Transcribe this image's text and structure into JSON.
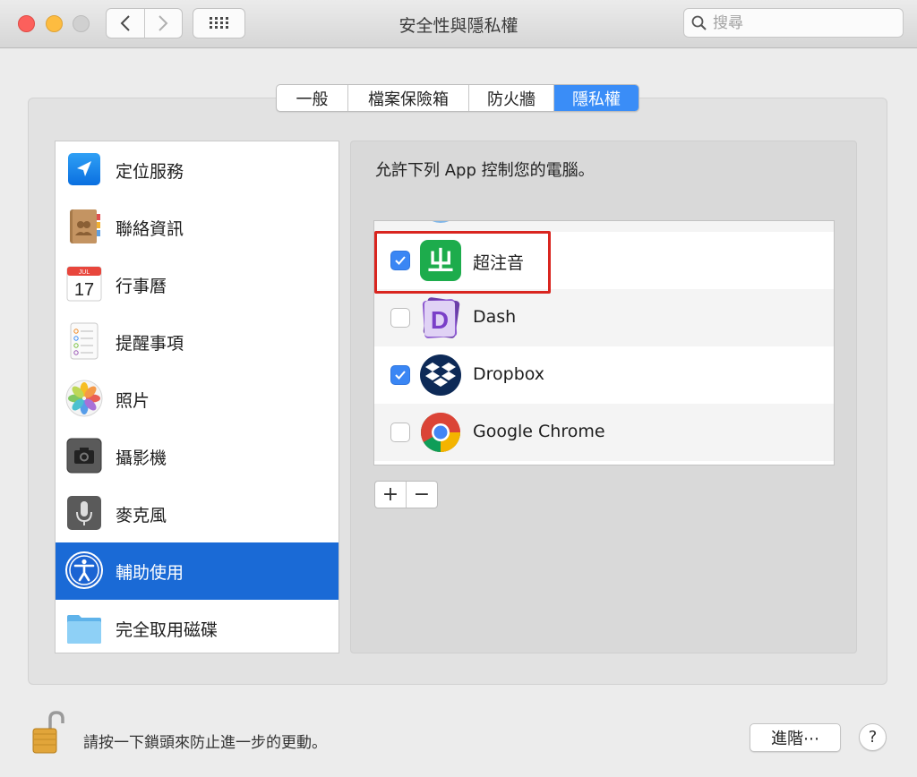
{
  "window": {
    "title": "安全性與隱私權"
  },
  "search": {
    "placeholder": "搜尋"
  },
  "tabs": [
    {
      "label": "一般",
      "active": false
    },
    {
      "label": "檔案保險箱",
      "active": false
    },
    {
      "label": "防火牆",
      "active": false
    },
    {
      "label": "隱私權",
      "active": true
    }
  ],
  "sidebar": {
    "items": [
      {
        "label": "定位服務",
        "icon": "location-arrow-icon"
      },
      {
        "label": "聯絡資訊",
        "icon": "contacts-book-icon"
      },
      {
        "label": "行事曆",
        "icon": "calendar-icon",
        "cal_month": "JUL",
        "cal_day": "17"
      },
      {
        "label": "提醒事項",
        "icon": "reminders-list-icon"
      },
      {
        "label": "照片",
        "icon": "photos-flower-icon"
      },
      {
        "label": "攝影機",
        "icon": "camera-icon"
      },
      {
        "label": "麥克風",
        "icon": "microphone-icon"
      },
      {
        "label": "輔助使用",
        "icon": "accessibility-icon",
        "selected": true
      },
      {
        "label": "完全取用磁碟",
        "icon": "folder-icon"
      }
    ]
  },
  "content": {
    "description": "允許下列 App 控制您的電腦。",
    "apps": [
      {
        "name": "超注音",
        "checked": true,
        "icon": "zhuyin-app-icon",
        "glyph": "ㄓ"
      },
      {
        "name": "Dash",
        "checked": false,
        "icon": "dash-app-icon",
        "glyph": "D"
      },
      {
        "name": "Dropbox",
        "checked": true,
        "icon": "dropbox-app-icon"
      },
      {
        "name": "Google Chrome",
        "checked": false,
        "icon": "chrome-app-icon"
      }
    ],
    "add_label": "+",
    "remove_label": "−"
  },
  "footer": {
    "lock_text": "請按一下鎖頭來防止進一步的更動。",
    "advanced_label": "進階⋯",
    "help_label": "?"
  },
  "colors": {
    "accent": "#3a8df7",
    "selection": "#1a6ad6",
    "highlight_box": "#d9251f"
  }
}
